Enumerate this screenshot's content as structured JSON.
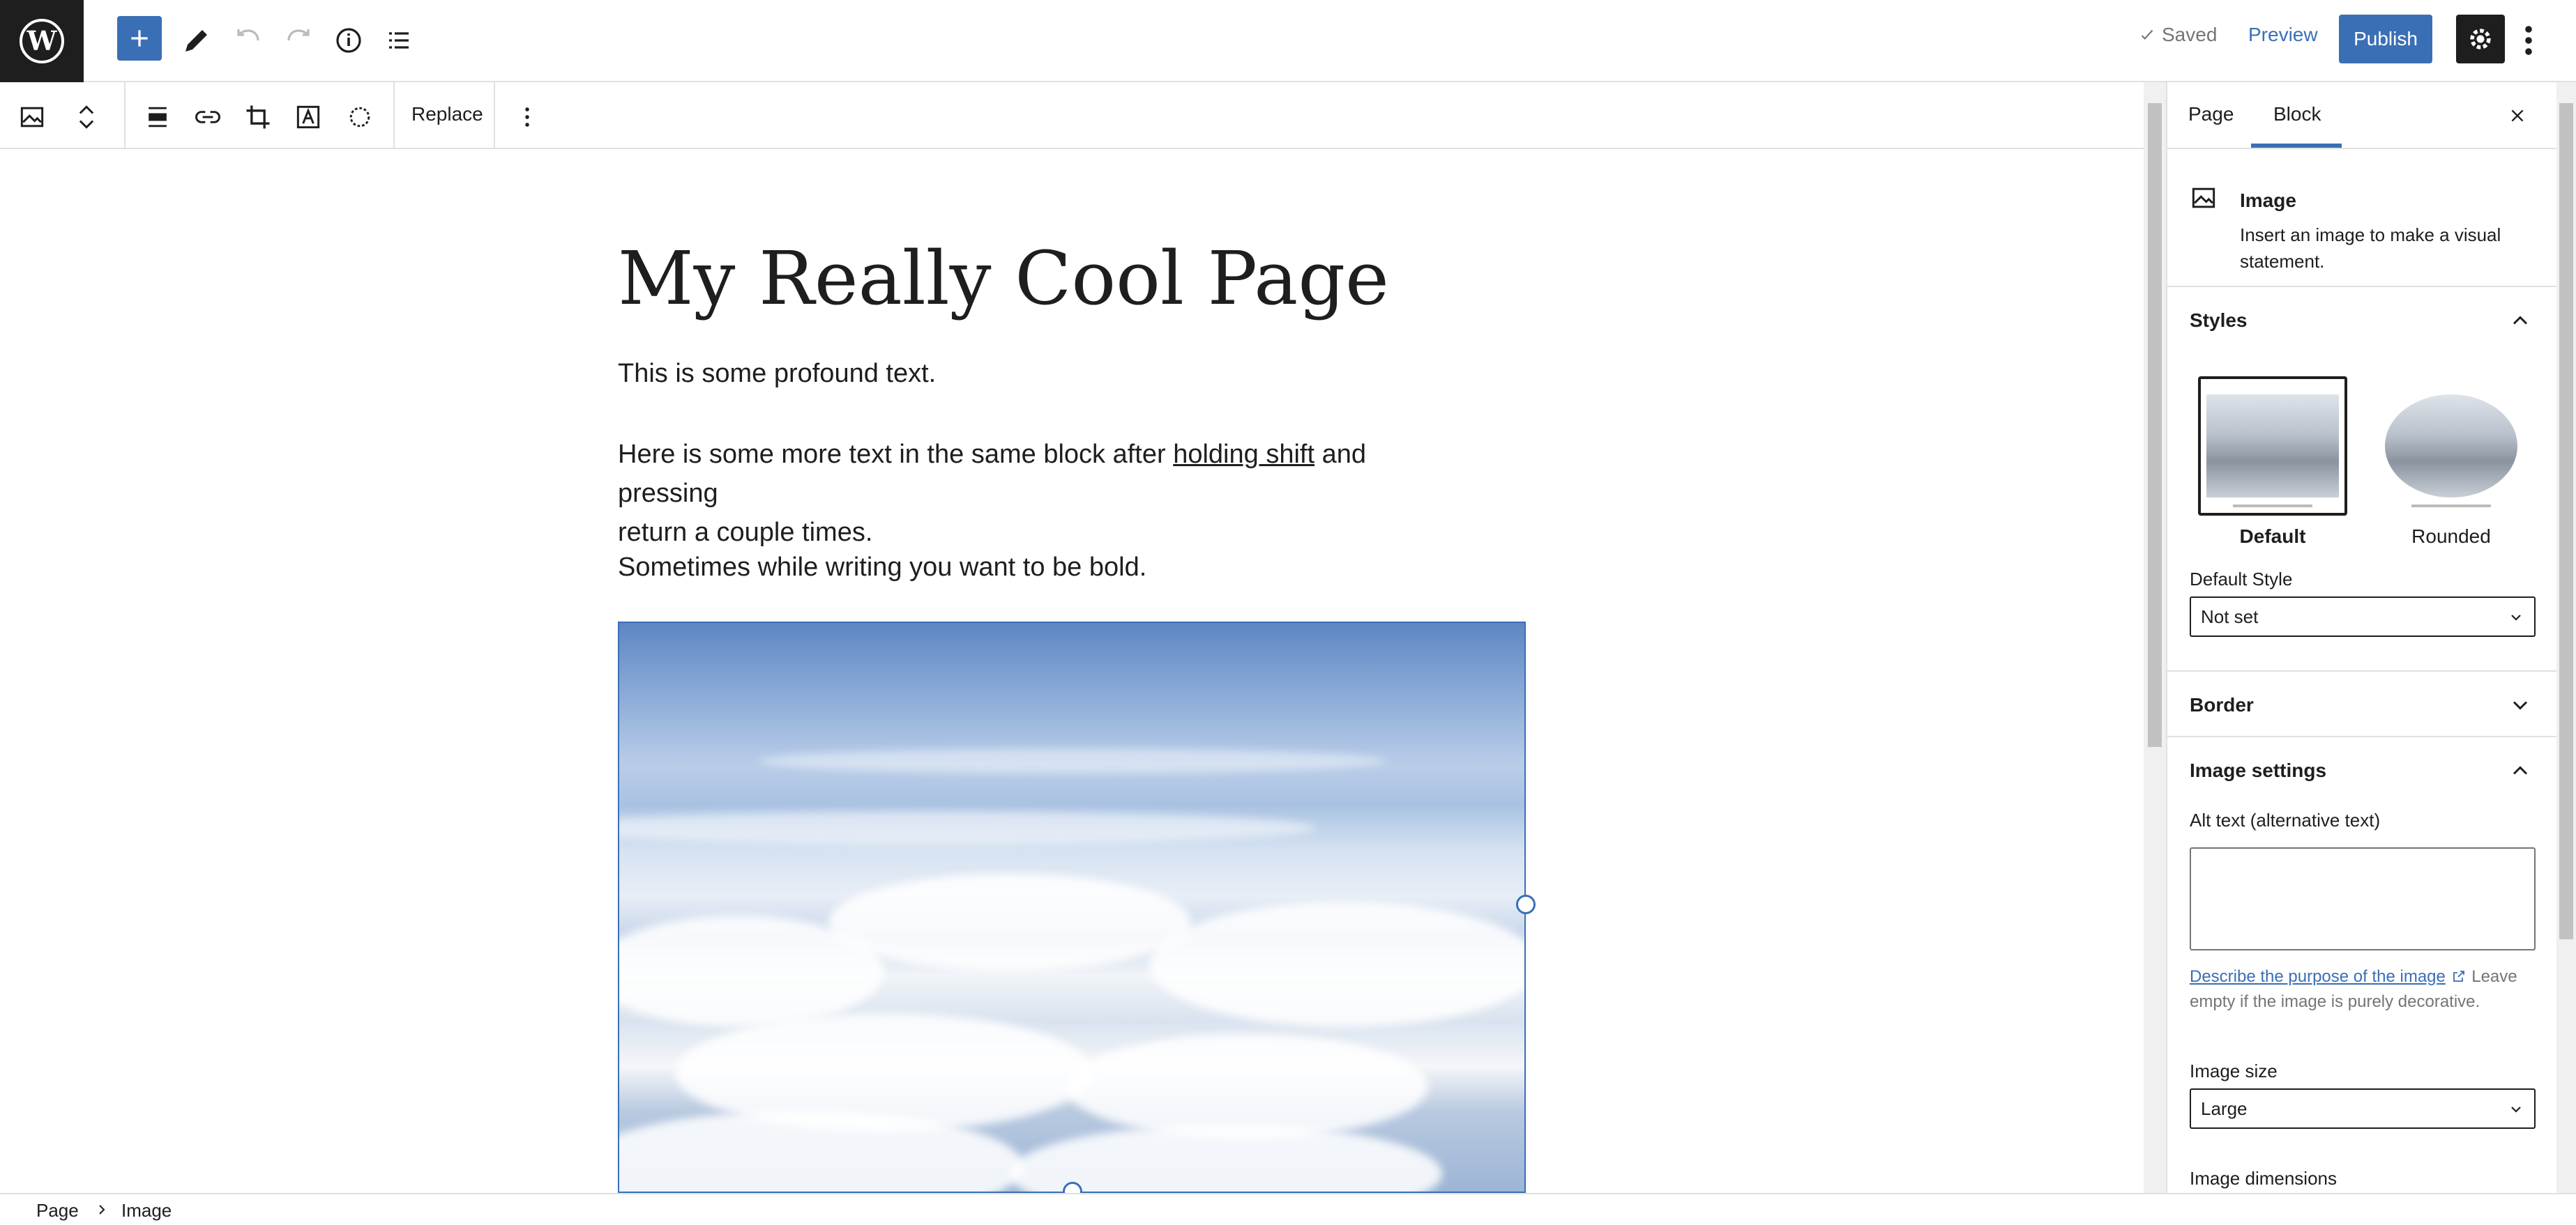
{
  "topbar": {
    "saved_label": "Saved",
    "preview_label": "Preview",
    "publish_label": "Publish"
  },
  "blockbar": {
    "replace_label": "Replace"
  },
  "editor": {
    "title": "My Really Cool Page",
    "para1": "This is some profound text.",
    "para2_before": "Here is some more text in the same block after ",
    "para2_link": "holding shift",
    "para2_after": " and pressing",
    "para2_line2": "return a couple times.",
    "para3": "Sometimes while writing you want to be bold."
  },
  "sidebar": {
    "tabs": [
      {
        "label": "Page"
      },
      {
        "label": "Block"
      }
    ],
    "block": {
      "title": "Image",
      "description": "Insert an image to make a visual statement."
    },
    "styles": {
      "title": "Styles",
      "options": [
        {
          "label": "Default"
        },
        {
          "label": "Rounded"
        }
      ],
      "default_style_label": "Default Style",
      "default_style_value": "Not set"
    },
    "border": {
      "title": "Border"
    },
    "image_settings": {
      "title": "Image settings",
      "alt_label": "Alt text (alternative text)",
      "alt_help_link": "Describe the purpose of the image",
      "alt_help_text": " Leave empty if the image is purely decorative.",
      "size_label": "Image size",
      "size_value": "Large",
      "dimensions_label": "Image dimensions"
    }
  },
  "footer": {
    "crumbs": [
      {
        "label": "Page"
      },
      {
        "label": "Image"
      }
    ]
  },
  "colors": {
    "accent": "#3a6fb5",
    "dark": "#1e1e1e",
    "border": "#e0e0e0"
  }
}
